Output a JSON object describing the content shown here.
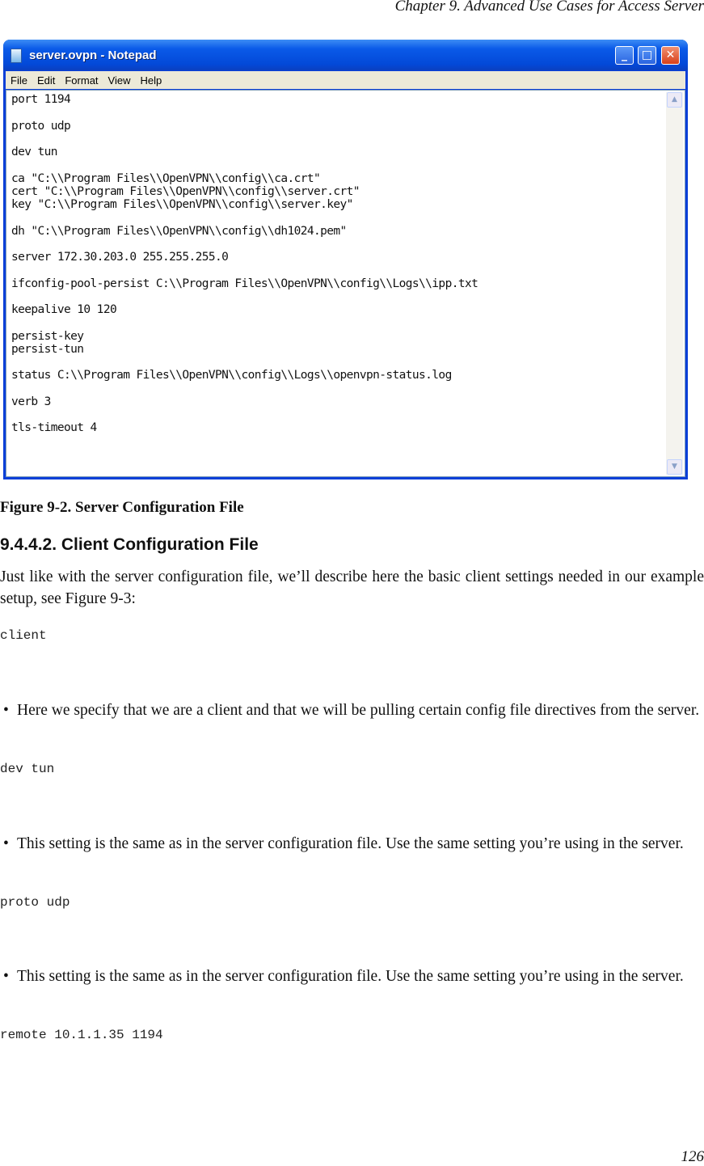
{
  "running_head": "Chapter 9. Advanced Use Cases for Access Server",
  "notepad": {
    "title": "server.ovpn - Notepad",
    "menu": [
      "File",
      "Edit",
      "Format",
      "View",
      "Help"
    ],
    "lines": [
      "port 1194",
      "",
      "proto udp",
      "",
      "dev tun",
      "",
      "ca \"C:\\\\Program Files\\\\OpenVPN\\\\config\\\\ca.crt\"",
      "cert \"C:\\\\Program Files\\\\OpenVPN\\\\config\\\\server.crt\"",
      "key \"C:\\\\Program Files\\\\OpenVPN\\\\config\\\\server.key\"",
      "",
      "dh \"C:\\\\Program Files\\\\OpenVPN\\\\config\\\\dh1024.pem\"",
      "",
      "server 172.30.203.0 255.255.255.0",
      "",
      "ifconfig-pool-persist C:\\\\Program Files\\\\OpenVPN\\\\config\\\\Logs\\\\ipp.txt",
      "",
      "keepalive 10 120",
      "",
      "persist-key",
      "persist-tun",
      "",
      "status C:\\\\Program Files\\\\OpenVPN\\\\config\\\\Logs\\\\openvpn-status.log",
      "",
      "verb 3",
      "",
      "tls-timeout 4"
    ]
  },
  "figure_caption": "Figure 9-2. Server Configuration File",
  "section_heading": "9.4.4.2. Client Configuration File",
  "intro": "Just like with the server configuration file, we’ll describe here the basic client settings needed in our example setup, see Figure 9-3:",
  "blocks": [
    {
      "code": "client",
      "bullet": "Here we specify that we are a client and that we will be pulling certain config file directives from the server."
    },
    {
      "code": "dev tun",
      "bullet": "This setting is the same as in the server configuration file. Use the same setting you’re using in the server."
    },
    {
      "code": "proto udp",
      "bullet": "This setting is the same as in the server configuration file. Use the same setting you’re using in the server."
    },
    {
      "code": "remote 10.1.1.35 1194"
    }
  ],
  "page_number": "126"
}
